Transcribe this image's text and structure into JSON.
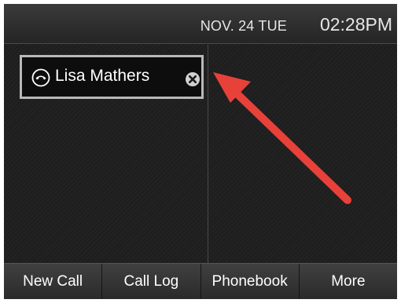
{
  "status_bar": {
    "date": "NOV. 24 TUE",
    "time": "02:28PM"
  },
  "call_entry": {
    "name": "Lisa Mathers",
    "icon": "handset-icon",
    "close_icon": "close-icon"
  },
  "softkeys": [
    "New Call",
    "Call Log",
    "Phonebook",
    "More"
  ],
  "annotation": {
    "arrow_color": "#e8413a"
  },
  "colors": {
    "screen_bg": "#1e1e1e",
    "highlight_border": "#b8b8b8"
  }
}
